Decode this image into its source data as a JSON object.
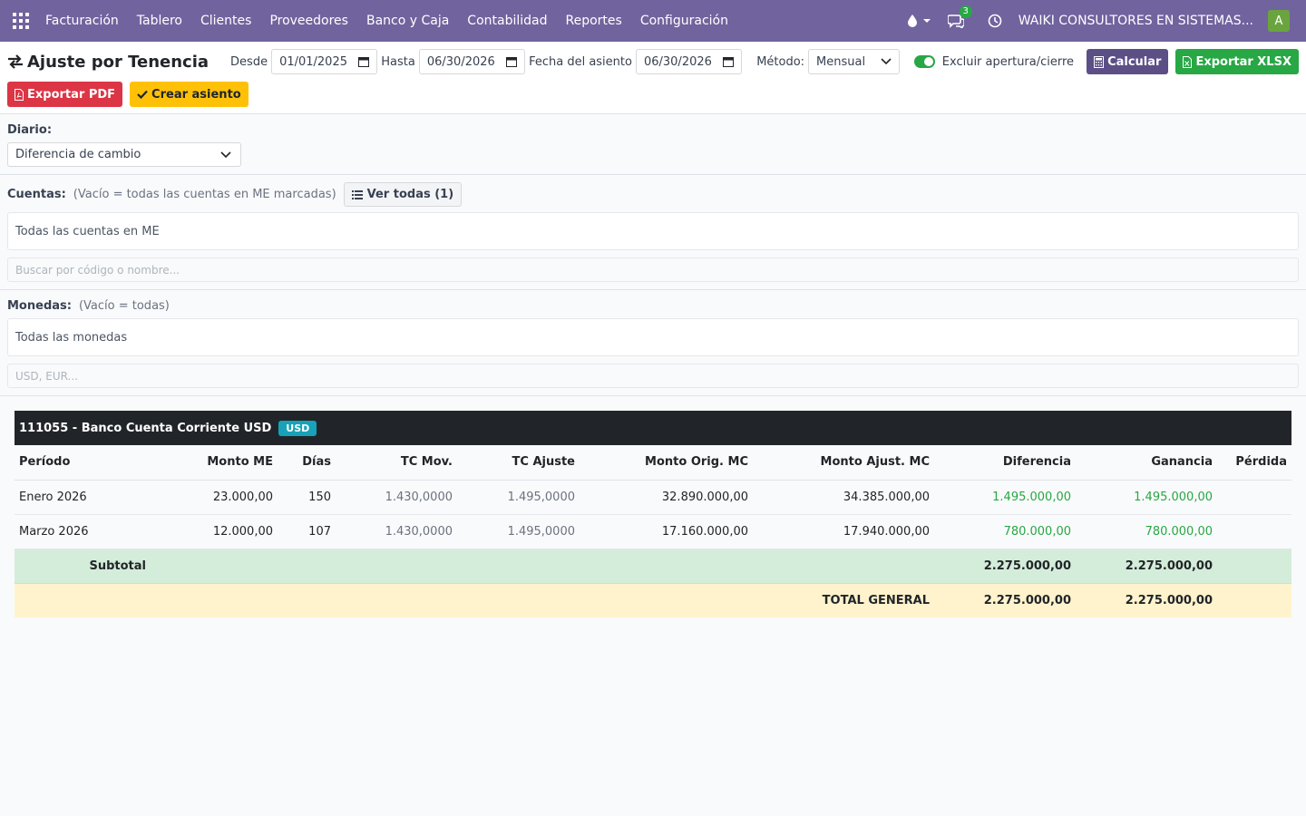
{
  "navbar": {
    "brand": "Facturación",
    "menu": [
      "Tablero",
      "Clientes",
      "Proveedores",
      "Banco y Caja",
      "Contabilidad",
      "Reportes",
      "Configuración"
    ],
    "chat_count": "3",
    "company": "WAIKI CONSULTORES EN SISTEMAS...",
    "avatar": "A",
    "colors": {
      "bar": "#71639e",
      "avatar": "#6aa43e"
    }
  },
  "controls": {
    "title": "Ajuste por Tenencia",
    "desde_label": "Desde",
    "desde_value": "01/01/2025",
    "hasta_label": "Hasta",
    "hasta_value": "06/30/2026",
    "fecha_label": "Fecha del asiento",
    "fecha_value": "06/30/2026",
    "metodo_label": "Método:",
    "metodo_value": "Mensual",
    "excluir_label": "Excluir apertura/cierre",
    "calcular": "Calcular",
    "exportar_xlsx": "Exportar XLSX",
    "exportar_pdf": "Exportar PDF",
    "crear_asiento": "Crear asiento"
  },
  "diario": {
    "label": "Diario:",
    "value": "Diferencia de cambio"
  },
  "cuentas": {
    "label": "Cuentas:",
    "hint": "(Vacío = todas las cuentas en ME marcadas)",
    "ver_todas": "Ver todas (1)",
    "box": "Todas las cuentas en ME",
    "search_placeholder": "Buscar por código o nombre..."
  },
  "monedas": {
    "label": "Monedas:",
    "hint": "(Vacío = todas)",
    "box": "Todas las monedas",
    "search_placeholder": "USD, EUR..."
  },
  "report": {
    "account": "111055 - Banco Cuenta Corriente USD",
    "currency_badge": "USD",
    "columns": [
      "Período",
      "Monto ME",
      "Días",
      "TC Mov.",
      "TC Ajuste",
      "Monto Orig. MC",
      "Monto Ajust. MC",
      "Diferencia",
      "Ganancia",
      "Pérdida"
    ],
    "rows": [
      [
        "Enero 2026",
        "23.000,00",
        "150",
        "1.430,0000",
        "1.495,0000",
        "32.890.000,00",
        "34.385.000,00",
        "1.495.000,00",
        "1.495.000,00",
        ""
      ],
      [
        "Marzo 2026",
        "12.000,00",
        "107",
        "1.430,0000",
        "1.495,0000",
        "17.160.000,00",
        "17.940.000,00",
        "780.000,00",
        "780.000,00",
        ""
      ]
    ],
    "subtotal": {
      "label": "Subtotal",
      "diferencia": "2.275.000,00",
      "ganancia": "2.275.000,00",
      "perdida": ""
    },
    "total": {
      "label": "TOTAL GENERAL",
      "diferencia": "2.275.000,00",
      "ganancia": "2.275.000,00",
      "perdida": ""
    }
  }
}
